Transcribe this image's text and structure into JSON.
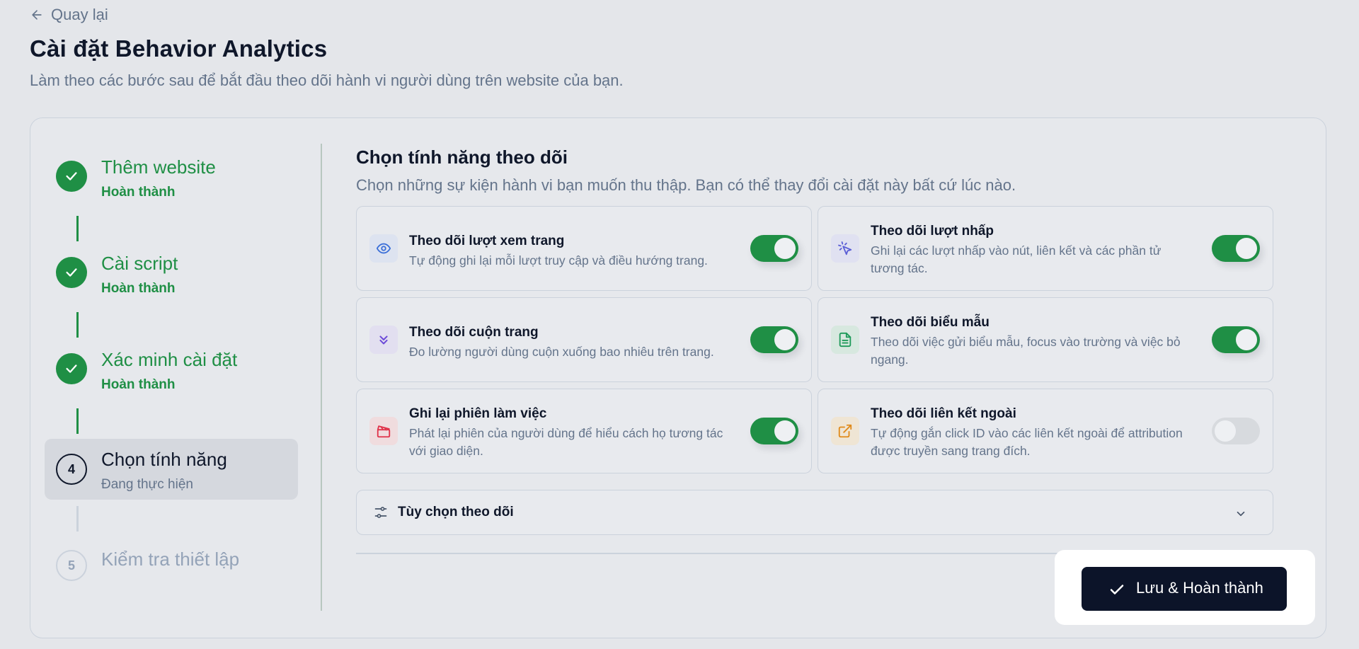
{
  "back": {
    "label": "Quay lại"
  },
  "header": {
    "title": "Cài đặt Behavior Analytics",
    "subtitle": "Làm theo các bước sau để bắt đầu theo dõi hành vi người dùng trên website của bạn."
  },
  "steps": [
    {
      "title": "Thêm website",
      "status": "Hoàn thành",
      "state": "done"
    },
    {
      "title": "Cài script",
      "status": "Hoàn thành",
      "state": "done"
    },
    {
      "title": "Xác minh cài đặt",
      "status": "Hoàn thành",
      "state": "done"
    },
    {
      "number": "4",
      "title": "Chọn tính năng",
      "status": "Đang thực hiện",
      "state": "active"
    },
    {
      "number": "5",
      "title": "Kiểm tra thiết lập",
      "state": "pending"
    }
  ],
  "main": {
    "title": "Chọn tính năng theo dõi",
    "subtitle": "Chọn những sự kiện hành vi bạn muốn thu thập. Bạn có thể thay đổi cài đặt này bất cứ lúc nào."
  },
  "features": [
    {
      "name": "Theo dõi lượt xem trang",
      "desc": "Tự động ghi lại mỗi lượt truy cập và điều hướng trang.",
      "icon": "eye-icon",
      "enabled": true
    },
    {
      "name": "Theo dõi lượt nhấp",
      "desc": "Ghi lại các lượt nhấp vào nút, liên kết và các phần tử tương tác.",
      "icon": "cursor-click-icon",
      "enabled": true
    },
    {
      "name": "Theo dõi cuộn trang",
      "desc": "Đo lường người dùng cuộn xuống bao nhiêu trên trang.",
      "icon": "chevrons-down-icon",
      "enabled": true
    },
    {
      "name": "Theo dõi biểu mẫu",
      "desc": "Theo dõi việc gửi biểu mẫu, focus vào trường và việc bỏ ngang.",
      "icon": "file-text-icon",
      "enabled": true
    },
    {
      "name": "Ghi lại phiên làm việc",
      "desc": "Phát lại phiên của người dùng để hiểu cách họ tương tác với giao diện.",
      "icon": "clapperboard-icon",
      "enabled": true
    },
    {
      "name": "Theo dõi liên kết ngoài",
      "desc": "Tự động gắn click ID vào các liên kết ngoài để attribution được truyền sang trang đích.",
      "icon": "external-link-icon",
      "enabled": false
    }
  ],
  "options": {
    "label": "Tùy chọn theo dõi"
  },
  "actions": {
    "save_label": "Lưu & Hoàn thành"
  },
  "colors": {
    "success": "#1f8f45",
    "primary_button": "#0c1429",
    "background": "#e4e6ea"
  }
}
